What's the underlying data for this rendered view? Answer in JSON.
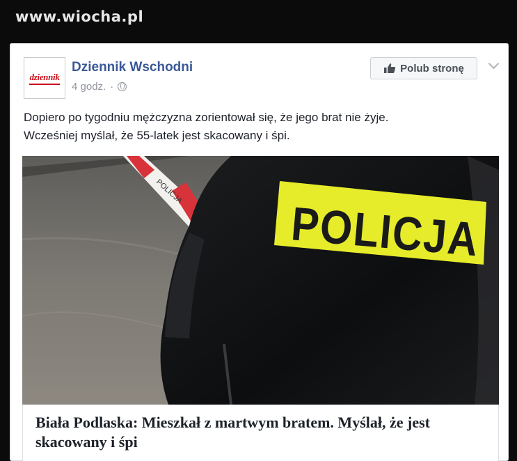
{
  "watermark": "www.wiocha.pl",
  "post": {
    "avatar_text": "dziennik",
    "page_name": "Dziennik Wschodni",
    "time": "4 godz.",
    "separator": "·",
    "like_button": "Polub stronę",
    "text_line1": "Dopiero po tygodniu mężczyzna zorientował się, że jego brat nie żyje.",
    "text_line2": "Wcześniej myślał, że 55-latek jest skacowany i śpi.",
    "image": {
      "tape_text": "POLICJA",
      "vest_text": "POLICJA"
    },
    "link": {
      "headline": "Biała Podlaska: Mieszkał z martwym bratem. Myślał, że jest skacowany i śpi"
    }
  },
  "colors": {
    "page_name": "#3b5998",
    "vest_yellow": "#e6ec2a",
    "tape_red": "#d8333a"
  },
  "icons": [
    "like-thumb-icon",
    "globe-icon",
    "chevron-down-icon"
  ]
}
